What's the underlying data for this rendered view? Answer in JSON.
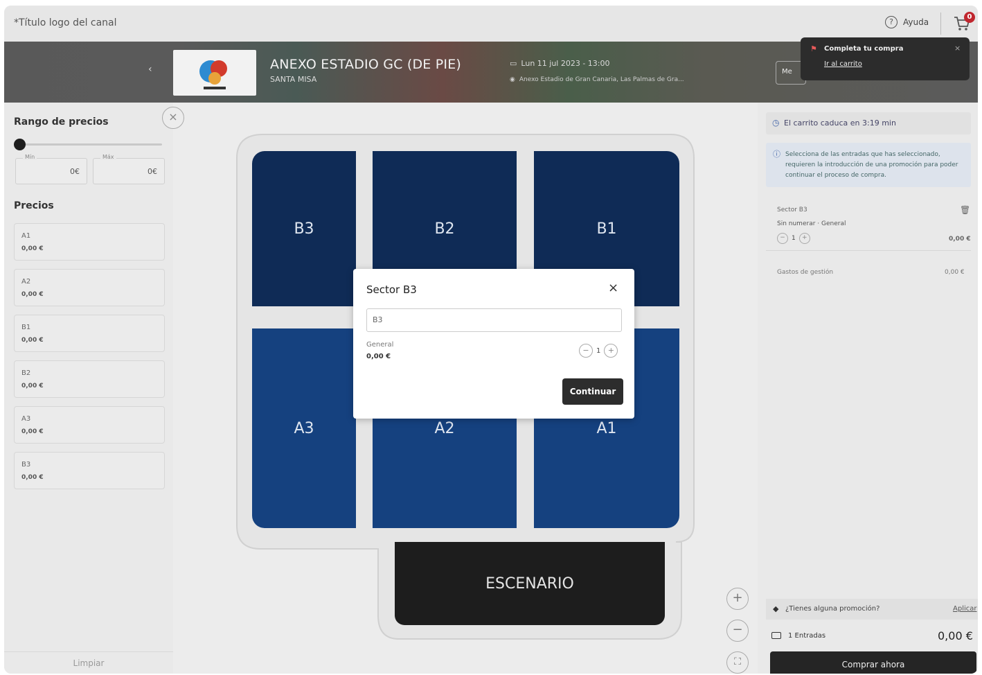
{
  "topbar": {
    "channel_logo": "*Título logo del canal",
    "help_label": "Ayuda",
    "help_icon": "?",
    "cart_count": "0"
  },
  "event": {
    "back_icon": "‹",
    "title": "ANEXO ESTADIO GC (DE PIE)",
    "subtitle": "SANTA MISA",
    "date": "Lun 11 jul 2023 - 13:00",
    "venue": "Anexo Estadio de Gran Canaria, Las Palmas de Gra...",
    "menu_label": "Me",
    "poster_colors": [
      "#d23b2c",
      "#2e8bd1",
      "#e8a33a"
    ]
  },
  "toast": {
    "title": "Completa tu compra",
    "link": "Ir al carrito",
    "close": "×"
  },
  "filters": {
    "range_title": "Rango de precios",
    "min_label": "Mín",
    "max_label": "Máx",
    "min_value": "0€",
    "max_value": "0€",
    "prices_title": "Precios",
    "prices": [
      {
        "name": "A1",
        "price": "0,00 €"
      },
      {
        "name": "A2",
        "price": "0,00 €"
      },
      {
        "name": "B1",
        "price": "0,00 €"
      },
      {
        "name": "B2",
        "price": "0,00 €"
      },
      {
        "name": "A3",
        "price": "0,00 €"
      },
      {
        "name": "B3",
        "price": "0,00 €"
      }
    ],
    "clear_label": "Limpiar",
    "collapse_icon": "×"
  },
  "map": {
    "sectors_top": [
      "B3",
      "B2",
      "B1"
    ],
    "sectors_bottom": [
      "A3",
      "A2",
      "A1"
    ],
    "stage_label": "ESCENARIO",
    "top_color": "#0f2b56",
    "bottom_color": "#15417f",
    "zoom_in": "+",
    "zoom_out": "−",
    "fit": "⛶"
  },
  "modal": {
    "title": "Sector B3",
    "close": "×",
    "input_value": "B3",
    "rate_label": "General",
    "rate_price": "0,00 €",
    "minus": "−",
    "quantity": "1",
    "plus": "+",
    "continue_label": "Continuar"
  },
  "cart": {
    "timer_text": "El carrito caduca en 3:19 min",
    "info_text": "Selecciona de las entradas que has seleccionado, requieren la introducción de una promoción para poder continuar el proceso de compra.",
    "item_sector": "Sector B3",
    "item_type": "Sin numerar · General",
    "item_qty": "1",
    "item_minus": "−",
    "item_plus": "+",
    "item_price": "0,00 €",
    "trash_icon": "🗑",
    "fees_label": "Gastos de gestión",
    "fees_value": "0,00 €",
    "promo_question": "¿Tienes alguna promoción?",
    "promo_apply": "Aplicar",
    "total_label": "1 Entradas",
    "total_amount": "0,00 €",
    "buy_label": "Comprar ahora"
  }
}
